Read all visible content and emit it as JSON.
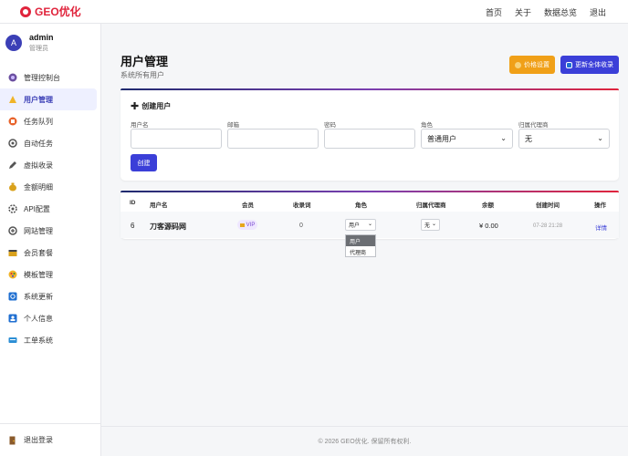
{
  "brand": {
    "name": "GEO优化",
    "color": "#e0243c"
  },
  "topnav": [
    "首页",
    "关于",
    "数据总览",
    "退出"
  ],
  "user": {
    "avatar": "A",
    "name": "admin",
    "role": "管理员"
  },
  "menu": [
    {
      "label": "管理控制台",
      "icon": "dashboard-icon"
    },
    {
      "label": "用户管理",
      "icon": "user-icon",
      "active": true
    },
    {
      "label": "任务队列",
      "icon": "queue-icon"
    },
    {
      "label": "自动任务",
      "icon": "auto-icon"
    },
    {
      "label": "虚拟收录",
      "icon": "pencil-icon"
    },
    {
      "label": "金额明细",
      "icon": "money-icon"
    },
    {
      "label": "API配置",
      "icon": "api-icon"
    },
    {
      "label": "网站管理",
      "icon": "site-icon"
    },
    {
      "label": "会员套餐",
      "icon": "package-icon"
    },
    {
      "label": "模板管理",
      "icon": "template-icon"
    },
    {
      "label": "系统更新",
      "icon": "update-icon"
    },
    {
      "label": "个人信息",
      "icon": "profile-icon"
    },
    {
      "label": "工单系统",
      "icon": "ticket-icon"
    }
  ],
  "logout": "退出登录",
  "page": {
    "title": "用户管理",
    "subtitle": "系统所有用户"
  },
  "actions": {
    "price": "价格设置",
    "update_all": "更新全体收录"
  },
  "create": {
    "title": "创建用户",
    "fields": [
      {
        "label": "用户名",
        "value": ""
      },
      {
        "label": "邮箱",
        "value": ""
      },
      {
        "label": "密码",
        "value": ""
      },
      {
        "label": "角色",
        "value": "普通用户"
      },
      {
        "label": "归属代理商",
        "value": "无"
      }
    ],
    "submit": "创建"
  },
  "table": {
    "headers": [
      "ID",
      "用户名",
      "会员",
      "收录词",
      "角色",
      "归属代理商",
      "余额",
      "创建时间",
      "操作"
    ],
    "rows": [
      {
        "id": "6",
        "username": "刀客源码网",
        "member": "VIP",
        "keywords": "0",
        "role": "用户",
        "agent": "无",
        "balance": "¥ 0.00",
        "created": "07-28 21:28",
        "action": "详情"
      }
    ]
  },
  "role_dropdown": [
    "用户",
    "代理商"
  ],
  "footer": "© 2026 GEO优化. 保留所有权利."
}
